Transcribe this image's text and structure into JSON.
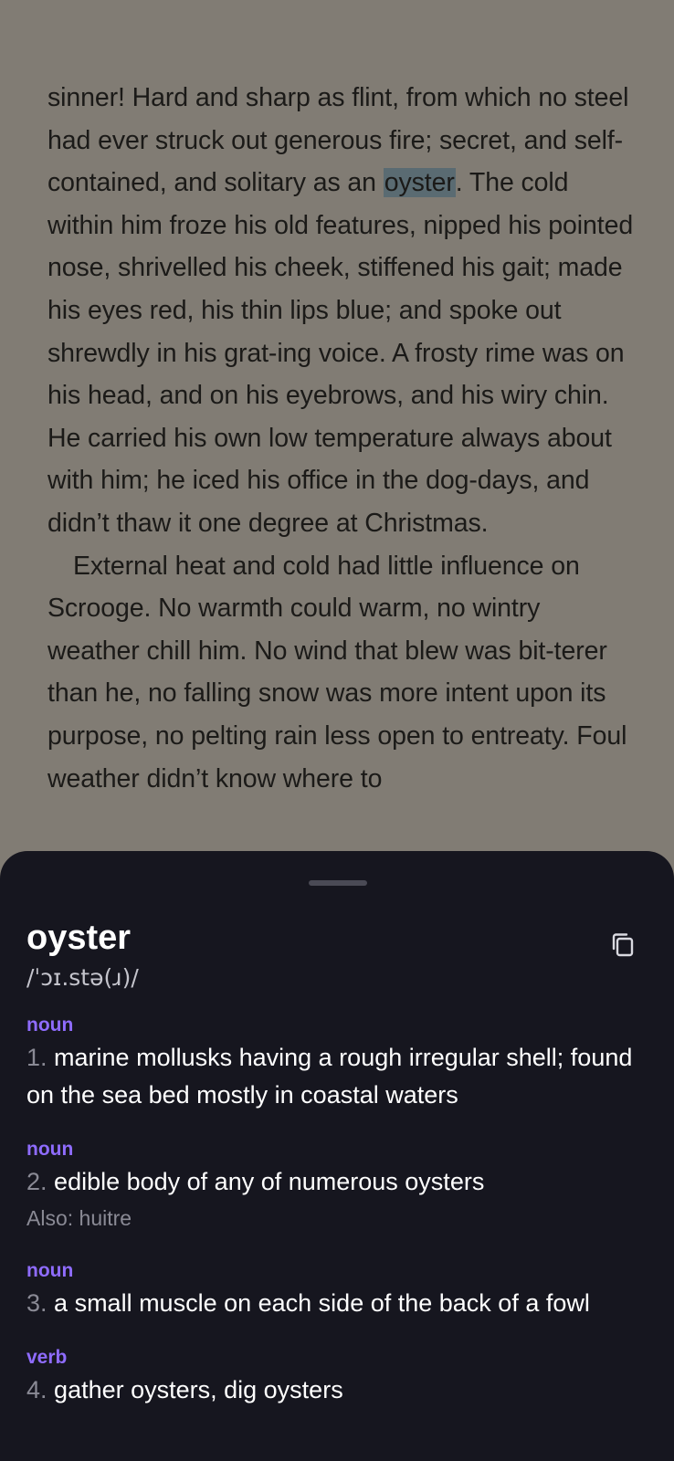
{
  "reader": {
    "paragraphs": [
      {
        "before": "sinner! Hard and sharp as flint, from which no steel had ever struck out generous fire; secret, and self-contained, and solitary as an ",
        "highlight": "oyster",
        "after": ". The cold within him froze his old features, nipped his pointed nose, shrivelled his cheek, stiffened his gait; made his eyes red, his thin lips blue; and spoke out shrewdly in his grat-ing voice. A frosty rime was on his head, and on his eyebrows, and his wiry chin. He carried his own low temperature always about with him; he iced his office in the dog-days, and didn’t thaw it one degree at Christmas."
      },
      {
        "text": "External heat and cold had little influence on Scrooge. No warmth could warm, no wintry weather chill him. No wind that blew was bit-terer than he, no falling snow was more intent upon its purpose, no pelting rain less open to entreaty. Foul weather didn’t know where to"
      }
    ]
  },
  "dictionary": {
    "word": "oyster",
    "pronunciation": "/ˈɔɪ.stə(ɹ)/",
    "copy_icon": "copy-icon",
    "definitions": [
      {
        "pos": "noun",
        "num": "1.",
        "text": "marine mollusks having a rough irregular shell; found on the sea bed mostly in coastal waters"
      },
      {
        "pos": "noun",
        "num": "2.",
        "text": "edible body of any of numerous oysters",
        "also": "Also: huitre"
      },
      {
        "pos": "noun",
        "num": "3.",
        "text": "a small muscle on each side of the back of a fowl"
      },
      {
        "pos": "verb",
        "num": "4.",
        "text": "gather oysters, dig oysters"
      }
    ]
  },
  "colors": {
    "reader_bg": "#817c74",
    "sheet_bg": "#16161f",
    "pos_accent": "#8f6cff",
    "highlight": "#5a6b72"
  }
}
